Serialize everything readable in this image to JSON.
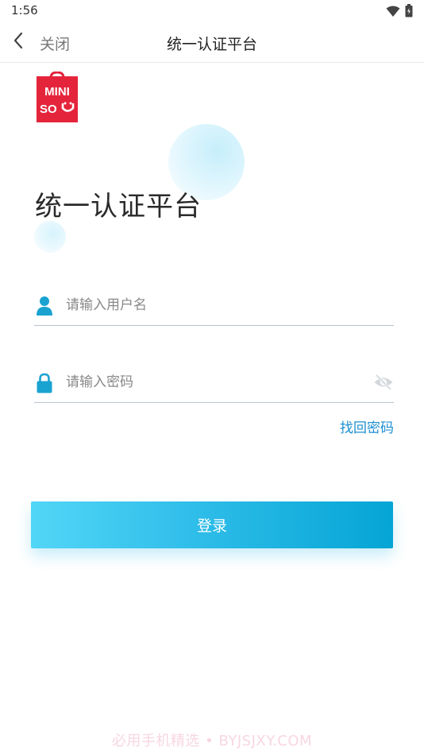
{
  "status_bar": {
    "time": "1:56",
    "icons": [
      "wifi-icon",
      "battery-icon"
    ]
  },
  "nav": {
    "back_icon": "chevron-left-icon",
    "close_label": "关闭",
    "title": "统一认证平台"
  },
  "logo": {
    "line1": "MINI",
    "line2": "SO",
    "brand_color": "#e4243b"
  },
  "heading": "统一认证平台",
  "form": {
    "username": {
      "icon": "user-icon",
      "value": "",
      "placeholder": "请输入用户名"
    },
    "password": {
      "icon": "lock-icon",
      "value": "",
      "placeholder": "请输入密码",
      "toggle_icon": "eye-off-icon"
    },
    "forgot_label": "找回密码",
    "submit_label": "登录"
  },
  "colors": {
    "accent": "#1ab0e0",
    "link": "#1e8fd0",
    "icon": "#1aa3d1"
  },
  "watermark": "必用手机精选 • BYJSJXY.COM"
}
